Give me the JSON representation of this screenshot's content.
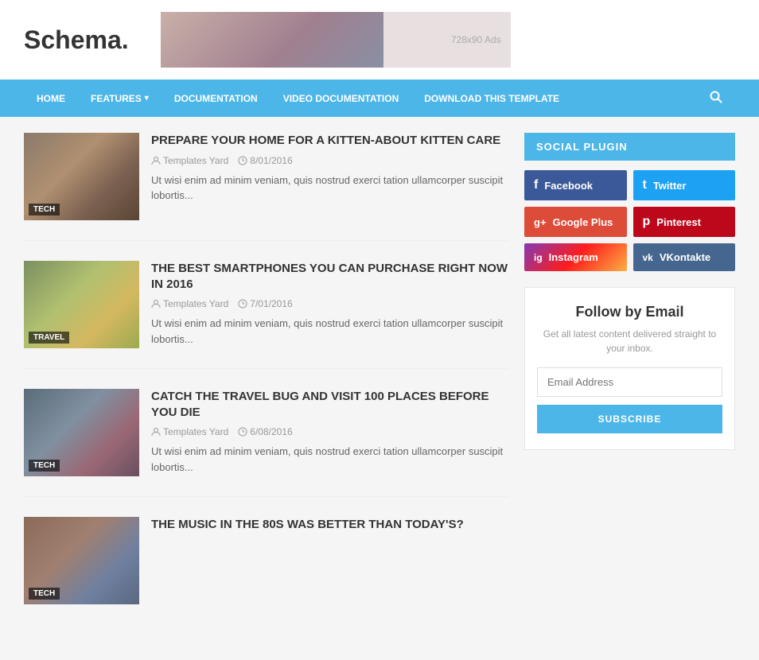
{
  "header": {
    "logo": "Schema",
    "logo_dot": ".",
    "ad_text": "728x90 Ads"
  },
  "nav": {
    "items": [
      {
        "label": "HOME",
        "has_dropdown": false
      },
      {
        "label": "FEATURES",
        "has_dropdown": true
      },
      {
        "label": "DOCUMENTATION",
        "has_dropdown": false
      },
      {
        "label": "VIDEO DOCUMENTATION",
        "has_dropdown": false
      },
      {
        "label": "DOWNLOAD THIS TEMPLATE",
        "has_dropdown": false
      }
    ]
  },
  "articles": [
    {
      "tag": "TECH",
      "title": "PREPARE YOUR HOME FOR A KITTEN-ABOUT KITTEN CARE",
      "author": "Templates Yard",
      "date": "8/01/2016",
      "excerpt": "Ut wisi enim ad minim veniam, quis nostrud exerci tation ullamcorper suscipit lobortis...",
      "thumb_class": "thumb-tech"
    },
    {
      "tag": "TRAVEL",
      "title": "THE BEST SMARTPHONES YOU CAN PURCHASE RIGHT NOW IN 2016",
      "author": "Templates Yard",
      "date": "7/01/2016",
      "excerpt": "Ut wisi enim ad minim veniam, quis nostrud exerci tation ullamcorper suscipit lobortis...",
      "thumb_class": "thumb-travel"
    },
    {
      "tag": "TECH",
      "title": "CATCH THE TRAVEL BUG AND VISIT 100 PLACES BEFORE YOU DIE",
      "author": "Templates Yard",
      "date": "6/08/2016",
      "excerpt": "Ut wisi enim ad minim veniam, quis nostrud exerci tation ullamcorper suscipit lobortis...",
      "thumb_class": "thumb-tech2"
    },
    {
      "tag": "TECH",
      "title": "THE MUSIC IN THE 80S WAS BETTER THAN TODAY'S?",
      "author": "",
      "date": "",
      "excerpt": "",
      "thumb_class": "thumb-tech3"
    }
  ],
  "sidebar": {
    "social_plugin": {
      "header": "SOCIAL PLUGIN",
      "buttons": [
        {
          "label": "Facebook",
          "icon": "f",
          "class": "fb"
        },
        {
          "label": "Twitter",
          "icon": "t",
          "class": "tw"
        },
        {
          "label": "Google Plus",
          "icon": "g+",
          "class": "gp"
        },
        {
          "label": "Pinterest",
          "icon": "p",
          "class": "pi"
        },
        {
          "label": "Instagram",
          "icon": "ig",
          "class": "ig"
        },
        {
          "label": "VKontakte",
          "icon": "vk",
          "class": "vk"
        }
      ]
    },
    "follow_email": {
      "title": "Follow by Email",
      "desc": "Get all latest content delivered straight to your inbox.",
      "placeholder": "Email Address",
      "button_label": "SUBSCRIBE"
    }
  }
}
